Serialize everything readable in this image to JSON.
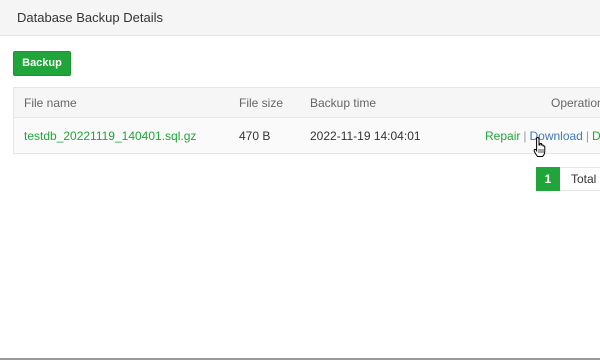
{
  "window": {
    "title": "Database Backup Details"
  },
  "toolbar": {
    "backup_label": "Backup"
  },
  "table": {
    "headers": {
      "file_name": "File name",
      "file_size": "File size",
      "backup_time": "Backup time",
      "operation": "Operation"
    },
    "rows": [
      {
        "file_name": "testdb_20221119_140401.sql.gz",
        "file_size": "470 B",
        "backup_time": "2022-11-19 14:04:01",
        "actions": {
          "repair": "Repair",
          "download": "Download",
          "delete": "De",
          "separator": "|"
        }
      }
    ]
  },
  "pagination": {
    "current_page": "1",
    "total_label": "Total"
  },
  "colors": {
    "accent": "#20a53a",
    "link_blue": "#3d7bb6"
  },
  "icons": {
    "cursor": "hand-pointer-icon"
  }
}
